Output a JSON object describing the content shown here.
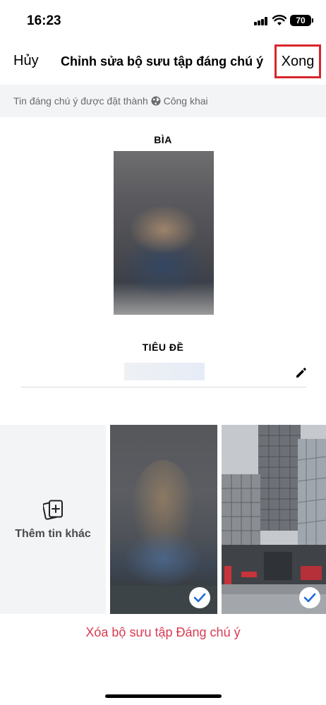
{
  "status": {
    "time": "16:23",
    "battery": "70"
  },
  "nav": {
    "cancel": "Hủy",
    "title": "Chỉnh sửa bộ sưu tập đáng chú ý",
    "done": "Xong"
  },
  "info": {
    "prefix": "Tin đáng chú ý được đặt thành",
    "audience": "Công khai"
  },
  "cover": {
    "label": "BÌA"
  },
  "title_section": {
    "label": "TIÊU ĐỀ"
  },
  "stories": {
    "add_label": "Thêm tin khác",
    "items": [
      {
        "selected": true
      },
      {
        "selected": true
      }
    ]
  },
  "delete": {
    "label": "Xóa bộ sưu tập Đáng chú ý"
  },
  "colors": {
    "accent": "#d83a52",
    "highlight_border": "#d8262c",
    "check": "#1f6ad8"
  },
  "icons": [
    "globe-icon",
    "pencil-icon",
    "add-story-icon",
    "check-icon",
    "signal-icon",
    "wifi-icon",
    "battery-icon"
  ]
}
